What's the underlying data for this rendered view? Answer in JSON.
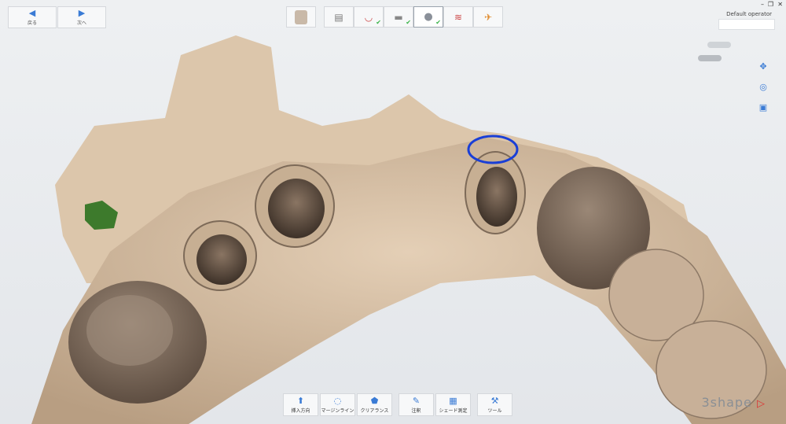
{
  "nav": {
    "back_label": "戻る",
    "forward_label": "次へ"
  },
  "workflow": {
    "steps": [
      {
        "name": "patient"
      },
      {
        "name": "prep"
      },
      {
        "name": "smile"
      },
      {
        "name": "scan-tool"
      },
      {
        "name": "scan"
      },
      {
        "name": "bite"
      },
      {
        "name": "review"
      }
    ]
  },
  "operator": {
    "name": "Default operator"
  },
  "bottom_toolbar": {
    "items": [
      {
        "label": "挿入方向",
        "icon": "insertion-icon"
      },
      {
        "label": "マージンライン",
        "icon": "margin-line-icon"
      },
      {
        "label": "クリアランス",
        "icon": "clearance-icon"
      },
      {
        "label": "注釈",
        "icon": "annotation-icon"
      },
      {
        "label": "シェード測定",
        "icon": "shade-icon"
      },
      {
        "label": "ツール",
        "icon": "tool-icon"
      }
    ]
  },
  "brand": {
    "name": "3shape"
  },
  "colors": {
    "accent": "#3a7bd5",
    "scan": "#d9c2a6",
    "highlight": "#1a3fd6",
    "gingiva_mark": "#3d7a2c"
  }
}
